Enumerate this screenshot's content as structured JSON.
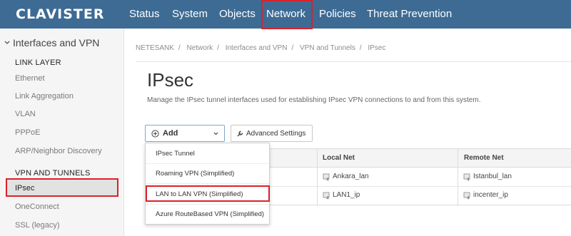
{
  "brand": {
    "logo_text": "CLAVISTER"
  },
  "topnav": {
    "items": [
      "Status",
      "System",
      "Objects",
      "Network",
      "Policies",
      "Threat Prevention"
    ],
    "active": "Network"
  },
  "sidebar": {
    "header": "Interfaces and VPN",
    "link_layer": {
      "title": "LINK LAYER",
      "items": [
        "Ethernet",
        "Link Aggregation",
        "VLAN",
        "PPPoE",
        "ARP/Neighbor Discovery"
      ]
    },
    "vpn_tunnels": {
      "title": "VPN AND TUNNELS",
      "items": [
        "IPsec",
        "OneConnect",
        "SSL (legacy)"
      ],
      "active": "IPsec"
    }
  },
  "breadcrumb": [
    "NETESANK",
    "Network",
    "Interfaces and VPN",
    "VPN and Tunnels",
    "IPsec"
  ],
  "page": {
    "title": "IPsec",
    "description": "Manage the IPsec tunnel interfaces used for establishing IPsec VPN connections to and from this system."
  },
  "toolbar": {
    "add_label": "Add",
    "advanced_label": "Advanced Settings"
  },
  "dropdown": {
    "items": [
      "IPsec Tunnel",
      "Roaming VPN (Simplified)",
      "LAN to LAN VPN (Simplified)",
      "Azure RouteBased VPN (Simplified)"
    ],
    "highlighted": "LAN to LAN VPN (Simplified)"
  },
  "table": {
    "columns": [
      "Local Net",
      "Remote Net"
    ],
    "rows": [
      {
        "local_net": "Ankara_lan",
        "remote_net": "Istanbul_lan"
      },
      {
        "local_net": "LAN1_ip",
        "remote_net": "incenter_ip"
      }
    ]
  },
  "colors": {
    "topbar": "#3d6b94",
    "highlight": "#d9222a",
    "sidebar_bg": "#f5f5f5"
  }
}
